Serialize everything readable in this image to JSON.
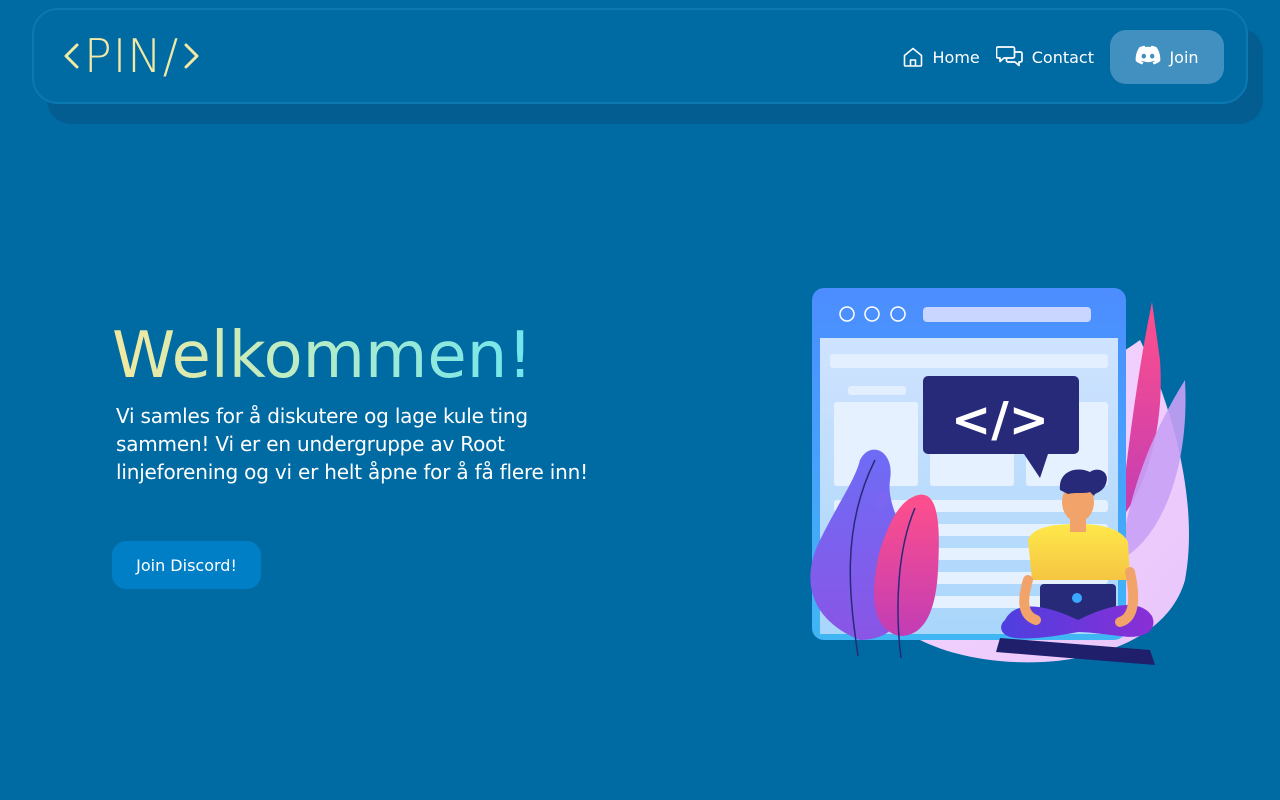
{
  "header": {
    "logo_text": "PIN/",
    "nav": [
      {
        "label": "Home",
        "icon": "home-icon"
      },
      {
        "label": "Contact",
        "icon": "chat-bubbles-icon"
      }
    ],
    "join_button": {
      "label": "Join",
      "icon": "discord-icon"
    }
  },
  "hero": {
    "title": "Welkommen!",
    "text_lines": [
      "Vi samles for å diskutere og lage kule ting",
      "sammen! Vi er en undergruppe av Root",
      "linjeforening og vi er helt åpne for å få flere inn!"
    ],
    "cta_label": "Join Discord!",
    "illustration": {
      "code_bubble_text": "</>",
      "description_icon": "developer-illustration"
    }
  },
  "colors": {
    "background": "#006aa3",
    "logo": "#f1e9a4",
    "title_gradient_start": "#f3e99f",
    "title_gradient_end": "#6fe6ee",
    "join_button": "#4190bf",
    "cta_button": "#007ec6"
  }
}
